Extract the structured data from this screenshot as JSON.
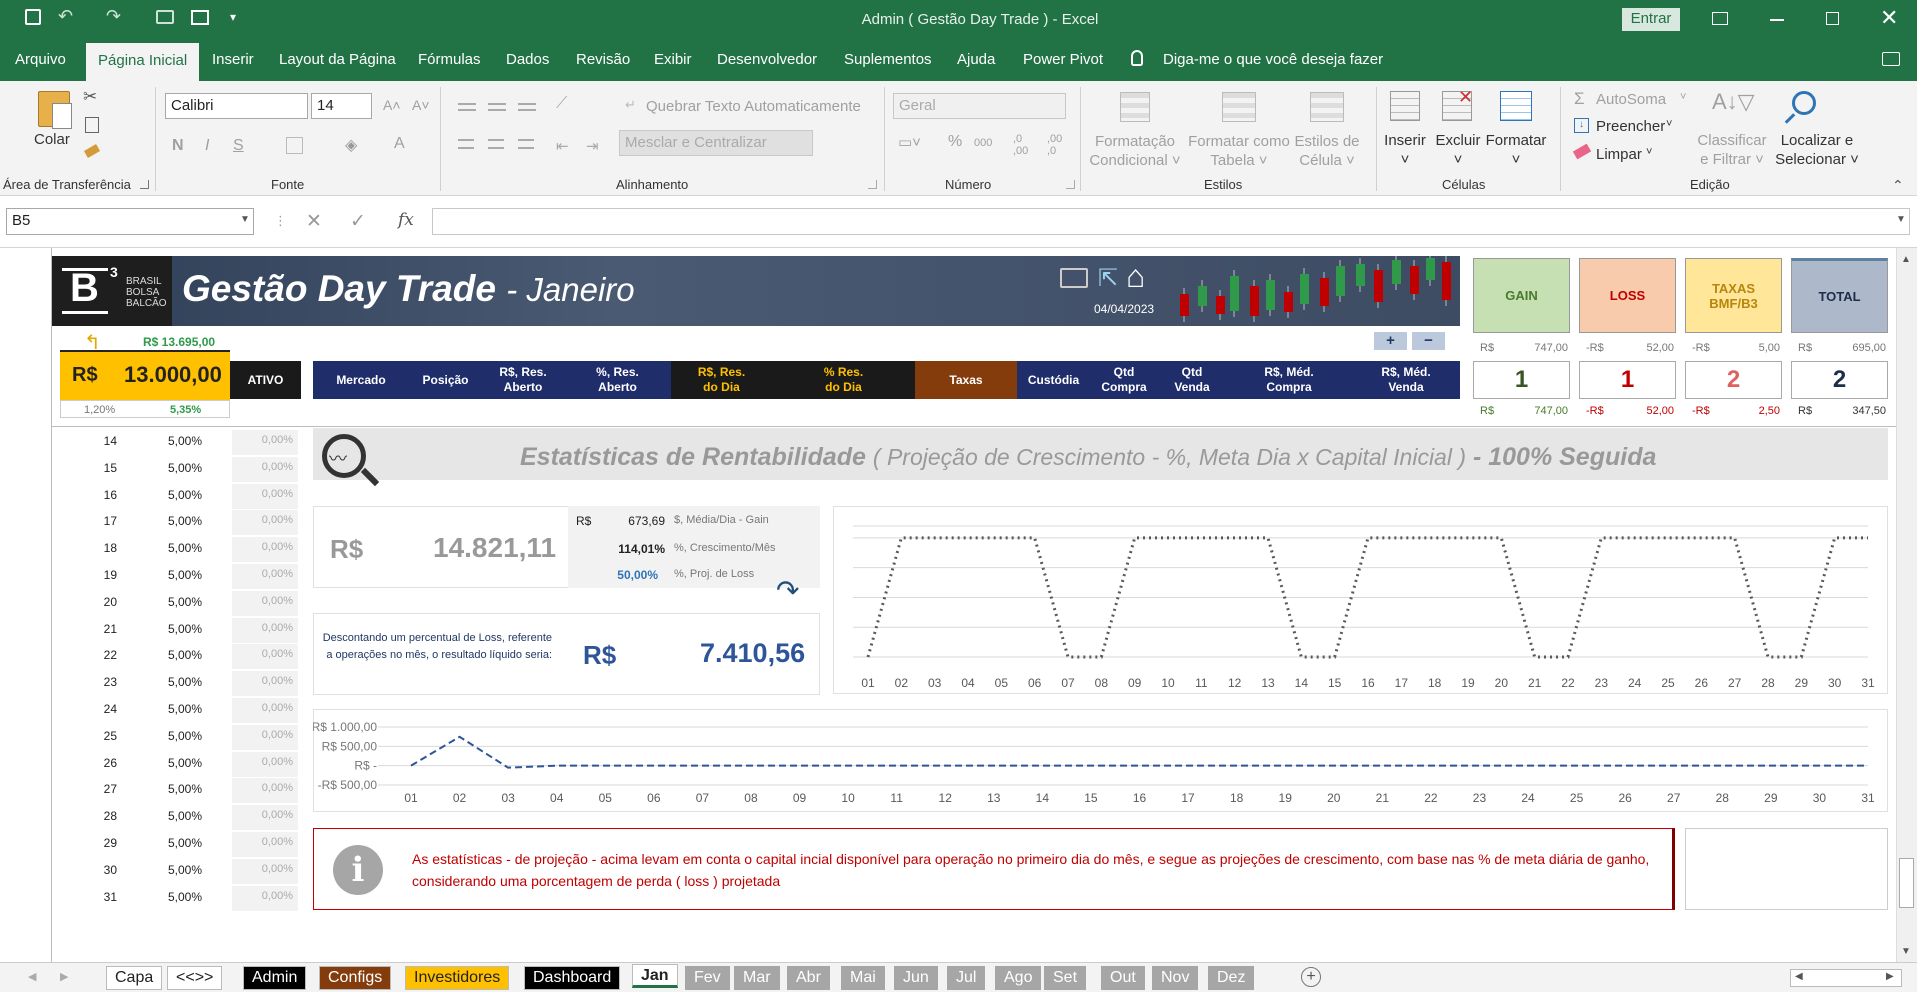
{
  "window": {
    "title": "Admin ( Gestão Day Trade )  -  Excel",
    "signin_label": "Entrar"
  },
  "menu": [
    "Arquivo",
    "Página Inicial",
    "Inserir",
    "Layout da Página",
    "Fórmulas",
    "Dados",
    "Revisão",
    "Exibir",
    "Desenvolvedor",
    "Suplementos",
    "Ajuda",
    "Power Pivot"
  ],
  "tellme": "Diga-me o que você deseja fazer",
  "ribbon": {
    "paste": "Colar",
    "clipboard": "Área de Transferência",
    "font_name": "Calibri",
    "font_size": "14",
    "bold": "N",
    "italic": "I",
    "underline": "S",
    "font_group": "Fonte",
    "wrap": "Quebrar Texto Automaticamente",
    "merge": "Mesclar e Centralizar",
    "align_group": "Alinhamento",
    "number_format": "Geral",
    "number_group": "Número",
    "cond_format_1": "Formatação",
    "cond_format_2": "Condicional",
    "format_table_1": "Formatar como",
    "format_table_2": "Tabela",
    "cell_styles_1": "Estilos de",
    "cell_styles_2": "Célula",
    "styles_group": "Estilos",
    "insert": "Inserir",
    "delete": "Excluir",
    "format": "Formatar",
    "cells_group": "Células",
    "autosum": "AutoSoma",
    "fill": "Preencher",
    "clear": "Limpar",
    "sort_1": "Classificar",
    "sort_2": "e Filtrar",
    "find_1": "Localizar e",
    "find_2": "Selecionar",
    "editing_group": "Edição"
  },
  "namebox": "B5",
  "fx": "fx",
  "dashboard": {
    "logo_b": "B",
    "logo_sup": "3",
    "logo_l1": "BRASIL",
    "logo_l2": "BOLSA",
    "logo_l3": "BALCÃO",
    "title": "Gestão Day Trade",
    "month": "- Janeiro",
    "date": "04/04/2023",
    "plus": "+",
    "minus": "−",
    "capital_top": "R$ 13.695,00",
    "capital_cur": "R$",
    "capital_val": "13.000,00",
    "pct_a": "1,20%",
    "pct_b": "5,35%",
    "ativo": "ATIVO",
    "headers": [
      "Mercado",
      "Posição",
      "R$, Res.\nAberto",
      "%, Res.\nAberto",
      "R$, Res.\ndo Dia",
      "% Res.\ndo Dia",
      "Taxas",
      "Custódia",
      "Qtd\nCompra",
      "Qtd\nVenda",
      "R$, Méd.\nCompra",
      "R$, Méd.\nVenda"
    ],
    "kpis": [
      {
        "label": "GAIN",
        "cur": "R$",
        "val": "747,00",
        "count": "1",
        "cur2": "R$",
        "val2": "747,00"
      },
      {
        "label": "LOSS",
        "cur": "-R$",
        "val": "52,00",
        "count": "1",
        "cur2": "-R$",
        "val2": "52,00"
      },
      {
        "label": "TAXAS\nBMF/B3",
        "cur": "-R$",
        "val": "5,00",
        "count": "2",
        "cur2": "-R$",
        "val2": "2,50"
      },
      {
        "label": "TOTAL",
        "cur": "R$",
        "val": "695,00",
        "count": "2",
        "cur2": "R$",
        "val2": "347,50"
      }
    ],
    "colors": {
      "gain": "#c6e0b4",
      "loss": "#f8cbad",
      "taxas": "#ffe699",
      "total": "#adb9ca",
      "navy": "#1f2d6b"
    }
  },
  "rows": [
    {
      "n": "14",
      "p": "5,00%",
      "z": "0,00%"
    },
    {
      "n": "15",
      "p": "5,00%",
      "z": "0,00%"
    },
    {
      "n": "16",
      "p": "5,00%",
      "z": "0,00%"
    },
    {
      "n": "17",
      "p": "5,00%",
      "z": "0,00%"
    },
    {
      "n": "18",
      "p": "5,00%",
      "z": "0,00%"
    },
    {
      "n": "19",
      "p": "5,00%",
      "z": "0,00%"
    },
    {
      "n": "20",
      "p": "5,00%",
      "z": "0,00%"
    },
    {
      "n": "21",
      "p": "5,00%",
      "z": "0,00%"
    },
    {
      "n": "22",
      "p": "5,00%",
      "z": "0,00%"
    },
    {
      "n": "23",
      "p": "5,00%",
      "z": "0,00%"
    },
    {
      "n": "24",
      "p": "5,00%",
      "z": "0,00%"
    },
    {
      "n": "25",
      "p": "5,00%",
      "z": "0,00%"
    },
    {
      "n": "26",
      "p": "5,00%",
      "z": "0,00%"
    },
    {
      "n": "27",
      "p": "5,00%",
      "z": "0,00%"
    },
    {
      "n": "28",
      "p": "5,00%",
      "z": "0,00%"
    },
    {
      "n": "29",
      "p": "5,00%",
      "z": "0,00%"
    },
    {
      "n": "30",
      "p": "5,00%",
      "z": "0,00%"
    },
    {
      "n": "31",
      "p": "5,00%",
      "z": "0,00%"
    }
  ],
  "stats": {
    "title": "Estatísticas de Rentabilidade",
    "subtitle": "( Projeção de Crescimento - %, Meta Dia x Capital Inicial )",
    "suffix": "- 100% Seguida",
    "proj_cur": "R$",
    "proj_val": "14.821,11",
    "m1_cur": "R$",
    "m1_val": "673,69",
    "m1_label": "$, Média/Dia - Gain",
    "m2_val": "114,01%",
    "m2_label": "%, Crescimento/Mês",
    "m3_val": "50,00%",
    "m3_label": "%, Proj. de Loss",
    "loss_text": "Descontando um percentual de Loss, referente a operações no mês, o resultado líquido seria:",
    "net_cur": "R$",
    "net_val": "7.410,56",
    "info": "As estatísticas - de projeção - acima levam em conta o capital incial disponível para operação no primeiro dia do mês, e segue as projeções de crescimento, com base nas % de meta diária de ganho, considerando uma porcentagem de perda ( loss ) projetada"
  },
  "chart_data": [
    {
      "type": "line",
      "x": [
        "01",
        "02",
        "03",
        "04",
        "05",
        "06",
        "07",
        "08",
        "09",
        "10",
        "11",
        "12",
        "13",
        "14",
        "15",
        "16",
        "17",
        "18",
        "19",
        "20",
        "21",
        "22",
        "23",
        "24",
        "25",
        "26",
        "27",
        "28",
        "29",
        "30",
        "31"
      ],
      "series": [
        {
          "values": [
            0,
            1,
            1,
            1,
            1,
            1,
            0,
            0,
            1,
            1,
            1,
            1,
            1,
            0,
            0,
            1,
            1,
            1,
            1,
            1,
            0,
            0,
            1,
            1,
            1,
            1,
            1,
            0,
            0,
            1,
            1
          ]
        }
      ],
      "ylim": [
        0,
        1.1
      ],
      "grid": true,
      "line_style": "dotted",
      "color": "#595959"
    },
    {
      "type": "line",
      "x": [
        "01",
        "02",
        "03",
        "04",
        "05",
        "06",
        "07",
        "08",
        "09",
        "10",
        "11",
        "12",
        "13",
        "14",
        "15",
        "16",
        "17",
        "18",
        "19",
        "20",
        "21",
        "22",
        "23",
        "24",
        "25",
        "26",
        "27",
        "28",
        "29",
        "30",
        "31"
      ],
      "series": [
        {
          "values": [
            0,
            747,
            -52,
            0,
            0,
            0,
            0,
            0,
            0,
            0,
            0,
            0,
            0,
            0,
            0,
            0,
            0,
            0,
            0,
            0,
            0,
            0,
            0,
            0,
            0,
            0,
            0,
            0,
            0,
            0,
            0
          ]
        }
      ],
      "y_ticks": [
        "R$ 1.000,00",
        "R$ 500,00",
        "R$ -",
        "-R$ 500,00"
      ],
      "ylim": [
        -500,
        1000
      ],
      "grid": true,
      "line_style": "dashed",
      "color": "#2e5597"
    }
  ],
  "sheets": [
    "Capa",
    "<<>>",
    "Admin",
    "Configs",
    "Investidores",
    "Dashboard",
    "Jan",
    "Fev",
    "Mar",
    "Abr",
    "Mai",
    "Jun",
    "Jul",
    "Ago",
    "Set",
    "Out",
    "Nov",
    "Dez"
  ],
  "sheet_colors": {
    "Admin": "#000000",
    "Configs": "#843c0c",
    "Investidores": "#ffc000",
    "Dashboard": "#000000"
  }
}
